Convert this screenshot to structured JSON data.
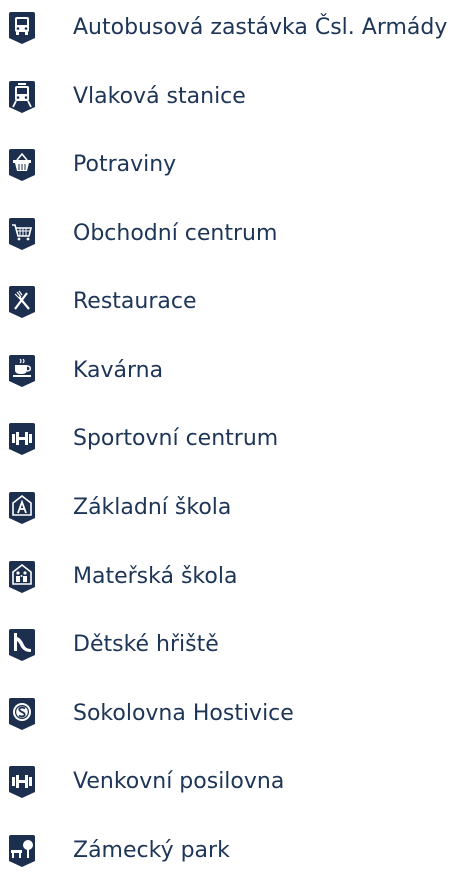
{
  "accent_color": "#1c2f4f",
  "text_color": "#1d3557",
  "items": [
    {
      "icon": "bus-stop-icon",
      "label": "Autobusová zastávka Čsl. Armády"
    },
    {
      "icon": "train-station-icon",
      "label": "Vlaková stanice"
    },
    {
      "icon": "grocery-basket-icon",
      "label": "Potraviny"
    },
    {
      "icon": "shopping-cart-icon",
      "label": "Obchodní centrum"
    },
    {
      "icon": "restaurant-cutlery-icon",
      "label": "Restaurace"
    },
    {
      "icon": "coffee-cup-icon",
      "label": "Kavárna"
    },
    {
      "icon": "dumbbell-icon",
      "label": "Sportovní centrum"
    },
    {
      "icon": "school-icon",
      "label": "Základní škola"
    },
    {
      "icon": "kindergarten-icon",
      "label": "Mateřská škola"
    },
    {
      "icon": "playground-slide-icon",
      "label": "Dětské hřiště"
    },
    {
      "icon": "sokol-emblem-icon",
      "label": "Sokolovna Hostivice"
    },
    {
      "icon": "dumbbell-icon",
      "label": "Venkovní posilovna"
    },
    {
      "icon": "park-bench-tree-icon",
      "label": "Zámecký park"
    }
  ]
}
